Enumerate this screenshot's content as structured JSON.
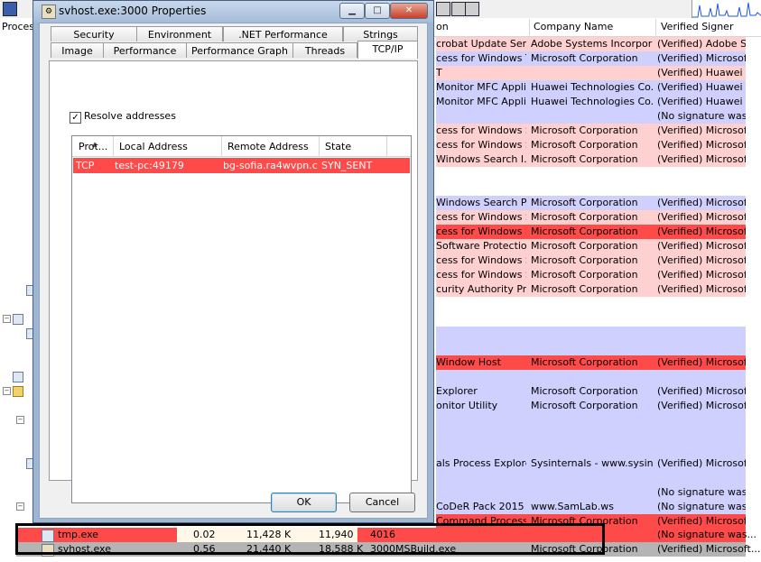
{
  "background": {
    "header": {
      "col_process": "Proces",
      "col_description": "on",
      "col_company": "Company Name",
      "col_signer": "Verified Signer"
    },
    "rows": [
      {
        "desc": "crobat Update Servi...",
        "company": "Adobe Systems Incorporated",
        "signer": "(Verified) Adobe S...",
        "color": "pink"
      },
      {
        "desc": "cess for Windows T...",
        "company": "Microsoft Corporation",
        "signer": "(Verified) Microsoft...",
        "color": "lav"
      },
      {
        "desc": "T",
        "company": "",
        "signer": "(Verified) Huawei ...",
        "color": "pink"
      },
      {
        "desc": "Monitor MFC Applic...",
        "company": "Huawei Technologies Co.,...",
        "signer": "(Verified) Huawei ...",
        "color": "lav"
      },
      {
        "desc": "Monitor MFC Applic...",
        "company": "Huawei Technologies Co.,...",
        "signer": "(Verified) Huawei ...",
        "color": "lav"
      },
      {
        "desc": "",
        "company": "",
        "signer": "(No signature was...",
        "color": "lav"
      },
      {
        "desc": "cess for Windows S...",
        "company": "Microsoft Corporation",
        "signer": "(Verified) Microsoft...",
        "color": "pink"
      },
      {
        "desc": "cess for Windows S...",
        "company": "Microsoft Corporation",
        "signer": "(Verified) Microsoft...",
        "color": "pink"
      },
      {
        "desc": "Windows Search I...",
        "company": "Microsoft Corporation",
        "signer": "(Verified) Microsoft...",
        "color": "pink"
      },
      {
        "desc": "",
        "company": "",
        "signer": "",
        "color": "none"
      },
      {
        "desc": "",
        "company": "",
        "signer": "",
        "color": "none"
      },
      {
        "desc": "Windows Search P...",
        "company": "Microsoft Corporation",
        "signer": "(Verified) Microsoft...",
        "color": "lav"
      },
      {
        "desc": "cess for Windows S...",
        "company": "Microsoft Corporation",
        "signer": "(Verified) Microsoft...",
        "color": "pink"
      },
      {
        "desc": "cess for Windows S...",
        "company": "Microsoft Corporation",
        "signer": "(Verified) Microsoft...",
        "color": "red"
      },
      {
        "desc": "Software Protectio...",
        "company": "Microsoft Corporation",
        "signer": "(Verified) Microsoft...",
        "color": "pink"
      },
      {
        "desc": "cess for Windows S...",
        "company": "Microsoft Corporation",
        "signer": "(Verified) Microsoft...",
        "color": "pink"
      },
      {
        "desc": "cess for Windows S...",
        "company": "Microsoft Corporation",
        "signer": "(Verified) Microsoft...",
        "color": "pink"
      },
      {
        "desc": "curity Authority Proc...",
        "company": "Microsoft Corporation",
        "signer": "(Verified) Microsoft...",
        "color": "pink"
      }
    ],
    "rows2": [
      {
        "desc": "Window Host",
        "company": "Microsoft Corporation",
        "signer": "(Verified) Microsoft...",
        "color": "red"
      },
      {
        "desc": "",
        "company": "",
        "signer": "",
        "color": "lav"
      },
      {
        "desc": "Explorer",
        "company": "Microsoft Corporation",
        "signer": "(Verified) Microsoft...",
        "color": "lav"
      },
      {
        "desc": "onitor Utility",
        "company": "Microsoft Corporation",
        "signer": "(Verified) Microsoft...",
        "color": "lav"
      }
    ],
    "rows3": [
      {
        "desc": "als Process Explorer",
        "company": "Sysinternals - www.sysinter...",
        "signer": "(Verified) Microsoft...",
        "color": "lav"
      }
    ],
    "rows4": [
      {
        "desc": "",
        "company": "",
        "signer": "(No signature was...",
        "color": "lav"
      },
      {
        "desc": "CoDeR Pack 2015 ...",
        "company": "www.SamLab.ws",
        "signer": "(No signature was...",
        "color": "lav"
      },
      {
        "desc": "Command Processor",
        "company": "Microsoft Corporation",
        "signer": "(Verified) Microsoft...",
        "color": "red"
      }
    ],
    "bottom_rows": [
      {
        "name": "tmp.exe",
        "cpu": "0.02",
        "private": "11,428 K",
        "working": "11,940 K",
        "pid": "4016",
        "desc": "",
        "company": "",
        "signer": "(No signature was..."
      },
      {
        "name": "svhost.exe",
        "cpu": "0.56",
        "private": "21,440 K",
        "working": "18,588 K",
        "pid": "3000",
        "desc": "MSBuild.exe",
        "company": "Microsoft Corporation",
        "signer": "(Verified) Microsoft..."
      }
    ]
  },
  "dialog": {
    "title": "svhost.exe:3000 Properties",
    "window_buttons": {
      "minimize": "▁",
      "maximize": "□",
      "close": "✕"
    },
    "tabs_row1": [
      "Security",
      "Environment",
      ".NET Performance",
      "Strings"
    ],
    "tabs_row2": [
      "Image",
      "Performance",
      "Performance Graph",
      "Threads",
      "TCP/IP"
    ],
    "active_tab": "TCP/IP",
    "resolve_label": "Resolve addresses",
    "resolve_checked": true,
    "columns": [
      "Prot...",
      "Local Address",
      "Remote Address",
      "State"
    ],
    "connections": [
      {
        "protocol": "TCP",
        "local": "test-pc:49179",
        "remote": "bg-sofia.ra4wvpn.c...",
        "state": "SYN_SENT"
      }
    ],
    "ok_label": "OK",
    "cancel_label": "Cancel"
  },
  "colors": {
    "pink": "#ffd0d0",
    "lavender": "#d0d0ff",
    "red": "#ff4a4a",
    "gray_row": "#b4b4b4"
  }
}
